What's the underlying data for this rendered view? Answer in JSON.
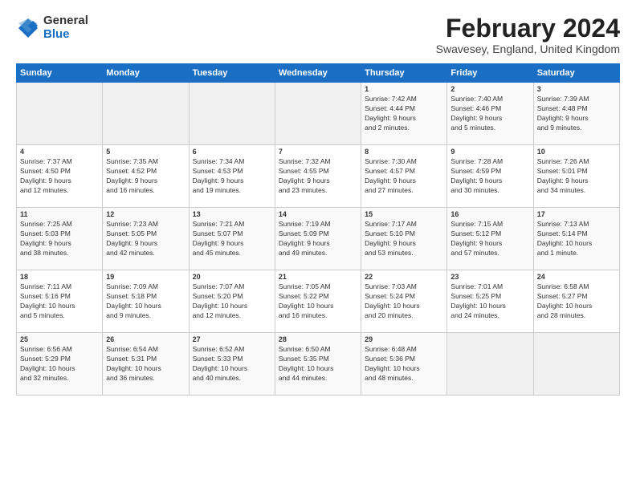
{
  "logo": {
    "general": "General",
    "blue": "Blue"
  },
  "title": "February 2024",
  "subtitle": "Swavesey, England, United Kingdom",
  "days_of_week": [
    "Sunday",
    "Monday",
    "Tuesday",
    "Wednesday",
    "Thursday",
    "Friday",
    "Saturday"
  ],
  "weeks": [
    [
      {
        "day": "",
        "info": ""
      },
      {
        "day": "",
        "info": ""
      },
      {
        "day": "",
        "info": ""
      },
      {
        "day": "",
        "info": ""
      },
      {
        "day": "1",
        "info": "Sunrise: 7:42 AM\nSunset: 4:44 PM\nDaylight: 9 hours\nand 2 minutes."
      },
      {
        "day": "2",
        "info": "Sunrise: 7:40 AM\nSunset: 4:46 PM\nDaylight: 9 hours\nand 5 minutes."
      },
      {
        "day": "3",
        "info": "Sunrise: 7:39 AM\nSunset: 4:48 PM\nDaylight: 9 hours\nand 9 minutes."
      }
    ],
    [
      {
        "day": "4",
        "info": "Sunrise: 7:37 AM\nSunset: 4:50 PM\nDaylight: 9 hours\nand 12 minutes."
      },
      {
        "day": "5",
        "info": "Sunrise: 7:35 AM\nSunset: 4:52 PM\nDaylight: 9 hours\nand 16 minutes."
      },
      {
        "day": "6",
        "info": "Sunrise: 7:34 AM\nSunset: 4:53 PM\nDaylight: 9 hours\nand 19 minutes."
      },
      {
        "day": "7",
        "info": "Sunrise: 7:32 AM\nSunset: 4:55 PM\nDaylight: 9 hours\nand 23 minutes."
      },
      {
        "day": "8",
        "info": "Sunrise: 7:30 AM\nSunset: 4:57 PM\nDaylight: 9 hours\nand 27 minutes."
      },
      {
        "day": "9",
        "info": "Sunrise: 7:28 AM\nSunset: 4:59 PM\nDaylight: 9 hours\nand 30 minutes."
      },
      {
        "day": "10",
        "info": "Sunrise: 7:26 AM\nSunset: 5:01 PM\nDaylight: 9 hours\nand 34 minutes."
      }
    ],
    [
      {
        "day": "11",
        "info": "Sunrise: 7:25 AM\nSunset: 5:03 PM\nDaylight: 9 hours\nand 38 minutes."
      },
      {
        "day": "12",
        "info": "Sunrise: 7:23 AM\nSunset: 5:05 PM\nDaylight: 9 hours\nand 42 minutes."
      },
      {
        "day": "13",
        "info": "Sunrise: 7:21 AM\nSunset: 5:07 PM\nDaylight: 9 hours\nand 45 minutes."
      },
      {
        "day": "14",
        "info": "Sunrise: 7:19 AM\nSunset: 5:09 PM\nDaylight: 9 hours\nand 49 minutes."
      },
      {
        "day": "15",
        "info": "Sunrise: 7:17 AM\nSunset: 5:10 PM\nDaylight: 9 hours\nand 53 minutes."
      },
      {
        "day": "16",
        "info": "Sunrise: 7:15 AM\nSunset: 5:12 PM\nDaylight: 9 hours\nand 57 minutes."
      },
      {
        "day": "17",
        "info": "Sunrise: 7:13 AM\nSunset: 5:14 PM\nDaylight: 10 hours\nand 1 minute."
      }
    ],
    [
      {
        "day": "18",
        "info": "Sunrise: 7:11 AM\nSunset: 5:16 PM\nDaylight: 10 hours\nand 5 minutes."
      },
      {
        "day": "19",
        "info": "Sunrise: 7:09 AM\nSunset: 5:18 PM\nDaylight: 10 hours\nand 9 minutes."
      },
      {
        "day": "20",
        "info": "Sunrise: 7:07 AM\nSunset: 5:20 PM\nDaylight: 10 hours\nand 12 minutes."
      },
      {
        "day": "21",
        "info": "Sunrise: 7:05 AM\nSunset: 5:22 PM\nDaylight: 10 hours\nand 16 minutes."
      },
      {
        "day": "22",
        "info": "Sunrise: 7:03 AM\nSunset: 5:24 PM\nDaylight: 10 hours\nand 20 minutes."
      },
      {
        "day": "23",
        "info": "Sunrise: 7:01 AM\nSunset: 5:25 PM\nDaylight: 10 hours\nand 24 minutes."
      },
      {
        "day": "24",
        "info": "Sunrise: 6:58 AM\nSunset: 5:27 PM\nDaylight: 10 hours\nand 28 minutes."
      }
    ],
    [
      {
        "day": "25",
        "info": "Sunrise: 6:56 AM\nSunset: 5:29 PM\nDaylight: 10 hours\nand 32 minutes."
      },
      {
        "day": "26",
        "info": "Sunrise: 6:54 AM\nSunset: 5:31 PM\nDaylight: 10 hours\nand 36 minutes."
      },
      {
        "day": "27",
        "info": "Sunrise: 6:52 AM\nSunset: 5:33 PM\nDaylight: 10 hours\nand 40 minutes."
      },
      {
        "day": "28",
        "info": "Sunrise: 6:50 AM\nSunset: 5:35 PM\nDaylight: 10 hours\nand 44 minutes."
      },
      {
        "day": "29",
        "info": "Sunrise: 6:48 AM\nSunset: 5:36 PM\nDaylight: 10 hours\nand 48 minutes."
      },
      {
        "day": "",
        "info": ""
      },
      {
        "day": "",
        "info": ""
      }
    ]
  ]
}
